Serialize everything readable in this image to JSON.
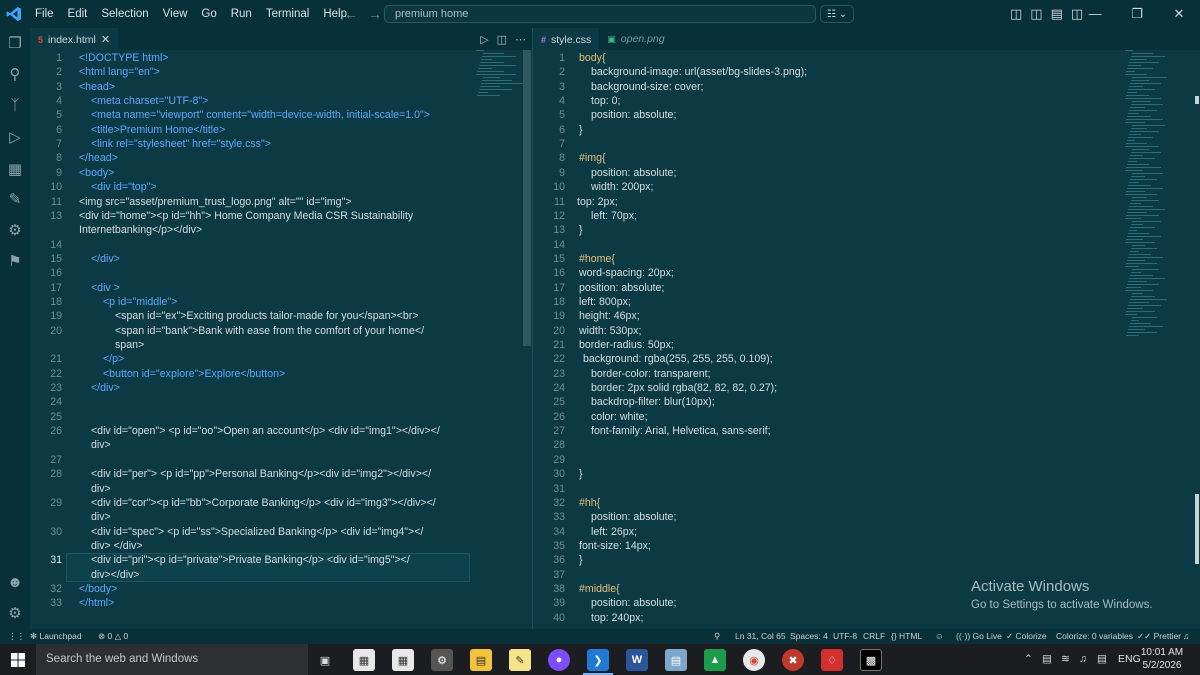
{
  "menu": [
    "File",
    "Edit",
    "Selection",
    "View",
    "Go",
    "Run",
    "Terminal",
    "Help"
  ],
  "search": {
    "value": "premium home"
  },
  "left_editor": {
    "tab": {
      "label": "index.html",
      "icon": "html5-icon"
    },
    "lines": [
      {
        "n": "1",
        "t": "<!DOCTYPE html>"
      },
      {
        "n": "2",
        "t": "<html lang=\"en\">"
      },
      {
        "n": "3",
        "t": "<head>"
      },
      {
        "n": "4",
        "t": "<meta charset=\"UTF-8\">"
      },
      {
        "n": "5",
        "t": "<meta name=\"viewport\" content=\"width=device-width, initial-scale=1.0\">"
      },
      {
        "n": "6",
        "t": "<title>Premium Home</title>"
      },
      {
        "n": "7",
        "t": "<link rel=\"stylesheet\" href=\"style.css\">"
      },
      {
        "n": "8",
        "t": "</head>"
      },
      {
        "n": "9",
        "t": "<body>"
      },
      {
        "n": "10",
        "t": "<div id=\"top\">"
      },
      {
        "n": "11",
        "t": "<img src=\"asset/premium_trust_logo.png\" alt=\"\" id=\"img\">"
      },
      {
        "n": "13",
        "t": "<div  id=\"home\"><p id=\"hh\"> Home  Company Media CSR Sustainability"
      },
      {
        "n": "",
        "t": "Internetbanking</p></div>"
      },
      {
        "n": "14",
        "t": ""
      },
      {
        "n": "15",
        "t": "</div>"
      },
      {
        "n": "16",
        "t": ""
      },
      {
        "n": "17",
        "t": "<div >"
      },
      {
        "n": "18",
        "t": "<p id=\"middle\">"
      },
      {
        "n": "19",
        "t": "<span id=\"ex\">Exciting products tailor-made for you</span><br>"
      },
      {
        "n": "20",
        "t": "<span id=\"bank\">Bank with ease from the comfort of your home</"
      },
      {
        "n": "",
        "t": "span>"
      },
      {
        "n": "21",
        "t": "</p>"
      },
      {
        "n": "22",
        "t": "<button id=\"explore\">Explore</button>"
      },
      {
        "n": "23",
        "t": "</div>"
      },
      {
        "n": "24",
        "t": ""
      },
      {
        "n": "25",
        "t": ""
      },
      {
        "n": "26",
        "t": "<div id=\"open\">  <p id=\"oo\">Open an account</p> <div id=\"img1\"></div></"
      },
      {
        "n": "",
        "t": "div>"
      },
      {
        "n": "27",
        "t": ""
      },
      {
        "n": "28",
        "t": "<div id=\"per\"> <p id=\"pp\">Personal Banking</p><div id=\"img2\"></div></"
      },
      {
        "n": "",
        "t": "div>"
      },
      {
        "n": "29",
        "t": "<div id=\"cor\"><p id=\"bb\">Corporate Banking</p> <div id=\"img3\"></div></"
      },
      {
        "n": "",
        "t": "div>"
      },
      {
        "n": "30",
        "t": "<div id=\"spec\"> <p id=\"ss\">Specialized Banking</p> <div id=\"img4\"></"
      },
      {
        "n": "",
        "t": "div> </div>"
      },
      {
        "n": "31",
        "t": "<div id=\"pri\"><p id=\"private\">Private Banking</p> <div id=\"img5\"></"
      },
      {
        "n": "",
        "t": "div></div>"
      },
      {
        "n": "32",
        "t": "</body>"
      },
      {
        "n": "33",
        "t": "</html>"
      }
    ]
  },
  "right_editor": {
    "tab": {
      "label": "style.css",
      "icon": "css-icon"
    },
    "tab2": {
      "label": "open.png",
      "icon": "image-icon"
    },
    "lines": [
      {
        "n": "1",
        "t": "body{"
      },
      {
        "n": "2",
        "t": "background-image: url(asset/bg-slides-3.png);"
      },
      {
        "n": "3",
        "t": "background-size: cover;"
      },
      {
        "n": "4",
        "t": "top: 0;"
      },
      {
        "n": "5",
        "t": "position: absolute;"
      },
      {
        "n": "6",
        "t": "}"
      },
      {
        "n": "7",
        "t": ""
      },
      {
        "n": "8",
        "t": "#img{"
      },
      {
        "n": "9",
        "t": "position: absolute;"
      },
      {
        "n": "10",
        "t": "width: 200px;"
      },
      {
        "n": "11",
        "t": "top: 2px;"
      },
      {
        "n": "12",
        "t": "left: 70px;"
      },
      {
        "n": "13",
        "t": "}"
      },
      {
        "n": "14",
        "t": ""
      },
      {
        "n": "15",
        "t": "#home{"
      },
      {
        "n": "16",
        "t": "word-spacing: 20px;"
      },
      {
        "n": "17",
        "t": "position: absolute;"
      },
      {
        "n": "18",
        "t": "left: 800px;"
      },
      {
        "n": "19",
        "t": "height: 46px;"
      },
      {
        "n": "20",
        "t": "width: 530px;"
      },
      {
        "n": "21",
        "t": "border-radius: 50px;"
      },
      {
        "n": "22",
        "t": "background: rgba(255, 255, 255, 0.109);"
      },
      {
        "n": "23",
        "t": "border-color: transparent;"
      },
      {
        "n": "24",
        "t": "border: 2px solid rgba(82, 82, 82, 0.27);"
      },
      {
        "n": "25",
        "t": "backdrop-filter: blur(10px);"
      },
      {
        "n": "26",
        "t": "color: white;"
      },
      {
        "n": "27",
        "t": "font-family: Arial, Helvetica, sans-serif;"
      },
      {
        "n": "28",
        "t": ""
      },
      {
        "n": "29",
        "t": ""
      },
      {
        "n": "30",
        "t": "}"
      },
      {
        "n": "31",
        "t": ""
      },
      {
        "n": "32",
        "t": "#hh{"
      },
      {
        "n": "33",
        "t": "position: absolute;"
      },
      {
        "n": "34",
        "t": "left: 26px;"
      },
      {
        "n": "35",
        "t": "font-size: 14px;"
      },
      {
        "n": "36",
        "t": "}"
      },
      {
        "n": "37",
        "t": ""
      },
      {
        "n": "38",
        "t": "#middle{"
      },
      {
        "n": "39",
        "t": "position: absolute;"
      },
      {
        "n": "40",
        "t": "top: 240px;"
      }
    ]
  },
  "watermark": {
    "title": "Activate Windows",
    "subtitle": "Go to Settings to activate Windows."
  },
  "statusbar": {
    "launchpad": "Launchpad",
    "problems": "0",
    "warnings": "0",
    "position": "Ln 31, Col 65",
    "spaces": "Spaces: 4",
    "encoding": "UTF-8",
    "eol": "CRLF",
    "language": "HTML",
    "golive": "Go Live",
    "colorize": "Colorize",
    "colorize_vars": "Colorize: 0 variables",
    "prettier": "Prettier"
  },
  "taskbar": {
    "search_placeholder": "Search the web and Windows",
    "lang": "ENG",
    "time": "10:01 AM",
    "date": "5/2/2026"
  }
}
